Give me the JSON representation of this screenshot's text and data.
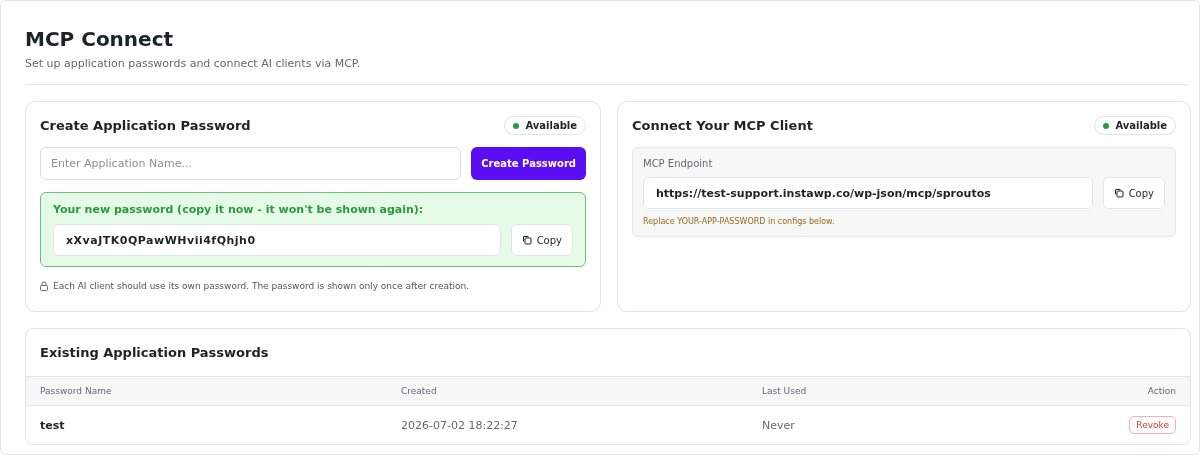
{
  "header": {
    "title": "MCP Connect",
    "subtitle": "Set up application passwords and connect AI clients via MCP."
  },
  "create_card": {
    "title": "Create Application Password",
    "status": "Available",
    "name_field": {
      "placeholder": "Enter Application Name..."
    },
    "create_button": "Create Password",
    "new_password": {
      "message": "Your new password (copy it now - it won't be shown again):",
      "value": "xXvaJTK0QPawWHvii4fQhjh0",
      "copy_button": "Copy"
    },
    "note": "Each AI client should use its own password. The password is shown only once after creation."
  },
  "connect_card": {
    "title": "Connect Your MCP Client",
    "status": "Available",
    "endpoint": {
      "label": "MCP Endpoint",
      "value": "https://test-support.instawp.co/wp-json/mcp/sproutos",
      "copy_button": "Copy",
      "hint": "Replace YOUR-APP-PASSWORD in configs below."
    }
  },
  "passwords_table": {
    "title": "Existing Application Passwords",
    "columns": [
      "Password Name",
      "Created",
      "Last Used",
      "Action"
    ],
    "rows": [
      {
        "name": "test",
        "created": "2026-07-02 18:22:27",
        "last_used": "Never",
        "action": "Revoke"
      }
    ]
  }
}
